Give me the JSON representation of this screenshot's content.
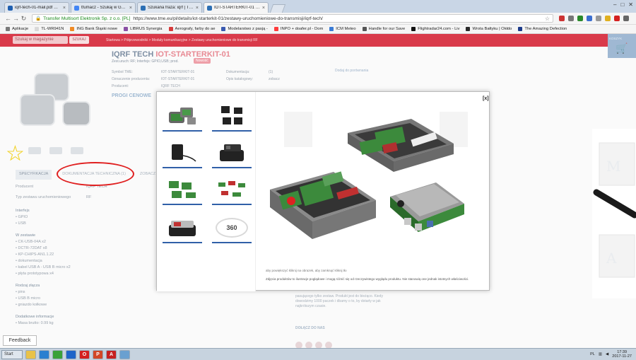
{
  "browser": {
    "tabs": [
      {
        "label": "iqrf-tech-01-mail.pdf — Otv",
        "color": "#1f5fb0"
      },
      {
        "label": "tfumacz - Szukaj w Google",
        "color": "#4285f4"
      },
      {
        "label": "Szukana fraza: iqrf | TME",
        "color": "#2c6fb4"
      },
      {
        "label": "IOT-STARTERKIT-01 IQRF",
        "color": "#2c6fb4"
      }
    ],
    "url_secure_label": "Transfer Multisort Elektronik Sp. z o.o. [PL]",
    "url": "https://www.tme.eu/pl/details/iot-starterkit-01/zestawy-uruchomieniowe-do-transmisji/iqrf-tech/",
    "bookmarks": [
      {
        "label": "Aplikacje",
        "color": "#7a7a7a"
      },
      {
        "label": "TL-WR941N",
        "color": "#d9d9d9"
      },
      {
        "label": "ING Bank Śląski nowe",
        "color": "#f08a24"
      },
      {
        "label": "LIBRUS Synergia",
        "color": "#8a4fa3"
      },
      {
        "label": "Aerografy, farby do ae",
        "color": "#d63a3a"
      },
      {
        "label": "Modelarstwo z pasją -",
        "color": "#3a5ab0"
      },
      {
        "label": "INPO + doafer.pl - Dom",
        "color": "#ff3b3b"
      },
      {
        "label": "ICM Meteo",
        "color": "#3a7bd5"
      },
      {
        "label": "Handle for our Save",
        "color": "#555555"
      },
      {
        "label": "Flightradar24.com - Liv",
        "color": "#111111"
      },
      {
        "label": "Wrota Bałtyku | Okłdo",
        "color": "#2a2a2a"
      },
      {
        "label": "The Amazing Defection",
        "color": "#1c3a8a"
      }
    ]
  },
  "site": {
    "search_placeholder": "Szukaj w magazynie",
    "search_button": "SZUKAJ",
    "breadcrumbs": "Startowa > Półprzewodniki > Moduły komunikacyjne > Zestawy uruchomieniowe do transmisji RF",
    "cart_label": "KOSZYK"
  },
  "product": {
    "title_main": "IQRF TECH",
    "title_code": "IOT-STARTERKIT-01",
    "subtitle": "Zest.uruch: RF; Interfejs: GPIO,USB; prod.",
    "badge": "Nowość",
    "specs_left": [
      {
        "k": "Symbol TME:",
        "v": "IOT-STARTERKIT-01"
      },
      {
        "k": "Oznaczenie producenta:",
        "v": "IOT-STARTERKIT-01"
      },
      {
        "k": "Producent:",
        "v": "IQRF TECH"
      }
    ],
    "specs_right": [
      {
        "k": "Dokumentacja:",
        "v": "(1)"
      },
      {
        "k": "Opis katalogowy:",
        "v": "zobacz"
      }
    ],
    "compare_link": "Dodaj do porównania",
    "price_heading": "PROGI CENOWE",
    "left_tabs": [
      "SPECYFIKACJA",
      "DOKUMENTACJA TECHNICZNA (1)",
      "ZOBACZ"
    ],
    "left_rows": [
      {
        "k": "Producent",
        "v": "IQRF TECH"
      },
      {
        "k": "Typ zestawu uruchomieniowego",
        "v": "RF"
      }
    ],
    "interfaces_head": "Interfejs",
    "interfaces": [
      "GPIO",
      "USB"
    ],
    "contents_head": "W zestawie",
    "contents": [
      "CK-USB-04A x2",
      "DCTR-72DAT x8",
      "KP-CHIPS-AN1.1.22",
      "dokumentacja",
      "kabel USB A - USB B micro x2",
      "płyta prototypowa x4"
    ],
    "connectors_head": "Rodzaj złącza",
    "connectors": [
      "pins",
      "USB B micro",
      "gniazdo kołkowe"
    ],
    "extra_head": "Dodatkowe informacje",
    "extra": [
      "Masa brutto: 0.99 kg"
    ],
    "right_text": "pasującego tylko zestaw. Produkt jest do bieżąco. Kiedy dowodzimy 1000 paczek i dbamy o to, by dotarły w jak najkrótszym czasie.",
    "join_label": "DOŁĄCZ DO NAS"
  },
  "modal": {
    "close_label": "[x]",
    "thumb_360_label": "360",
    "caption_short": "aby powiększyć kliknij na obrazek, aby zamknąć kliknij tło",
    "caption_long": "Zdjęcia produktów to ilustracje poglądowe i mogą różnić się od rzeczywistego wyglądu produktu. Nie stanowią one jednak istotnych właściwości."
  },
  "feedback_label": "Feedback",
  "taskbar": {
    "start": "Start",
    "icons": [
      {
        "glyph": "",
        "color": "#e8c24a",
        "name": "folder-icon"
      },
      {
        "glyph": "",
        "color": "#2a7fd0",
        "name": "ie-icon"
      },
      {
        "glyph": "",
        "color": "#3aa13a",
        "name": "chrome-icon"
      },
      {
        "glyph": "",
        "color": "#1e64c8",
        "name": "steam-icon"
      },
      {
        "glyph": "O",
        "color": "#d42020",
        "name": "opera-icon"
      },
      {
        "glyph": "P",
        "color": "#d24726",
        "name": "powerpoint-icon"
      },
      {
        "glyph": "A",
        "color": "#c62020",
        "name": "acrobat-icon"
      },
      {
        "glyph": "",
        "color": "#6aa0d0",
        "name": "app-icon"
      }
    ],
    "tray_lang": "PL",
    "time": "17:39",
    "date": "2017-11-27"
  },
  "colors": {
    "site_red": "#d93a4a",
    "accent_blue": "#3060a8",
    "annotation_red": "#e02020",
    "annotation_star": "#f1d22a"
  }
}
